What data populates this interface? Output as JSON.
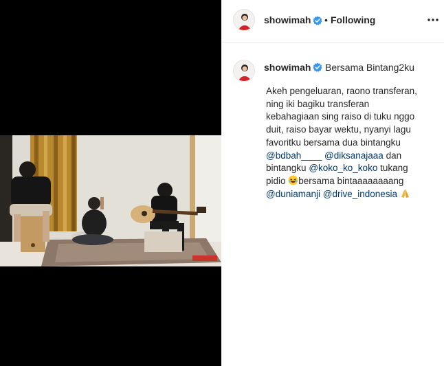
{
  "header": {
    "username": "showimah",
    "separator": "•",
    "follow_status": "Following",
    "more_icon": "more-horizontal-icon",
    "verified_icon": "verified-badge-icon"
  },
  "caption": {
    "username": "showimah",
    "title": "Bersama Bintang2ku",
    "line1": "Akeh pengeluaran, raono transferan,",
    "line2": "ning iki bagiku transferan",
    "line3": "kebahagiaan sing raiso di tuku nggo",
    "line4": "duit, raiso bayar wektu, nyanyi lagu",
    "line5": "favoritku bersama dua bintangku",
    "mention_bdbah": "@bdbah____",
    "mention_diksanajaaa": "@diksanajaaa",
    "text_dan": " dan",
    "text_bintangku": "bintangku ",
    "mention_koko": "@koko_ko_koko",
    "text_tukang": " tukang",
    "text_pidio": "pidio ",
    "text_bersama": "bersama bintaaaaaaaang",
    "mention_duniamanji": "@duniamanji",
    "mention_drive": "@drive_indonesia",
    "emoji_laugh": "laughing-emoji-icon",
    "emoji_pray": "folded-hands-emoji-icon"
  },
  "colors": {
    "mention": "#00376b",
    "verified": "#3897f0",
    "text": "#262626",
    "divider": "#efefef"
  }
}
